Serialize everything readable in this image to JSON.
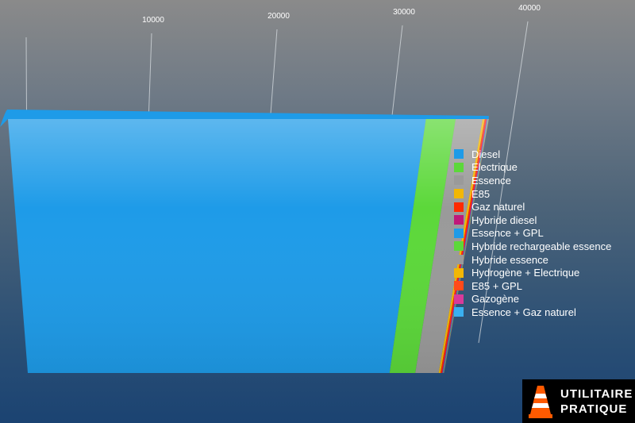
{
  "chart_data": {
    "type": "bar",
    "orientation": "horizontal",
    "stacked": true,
    "style": "3d",
    "grid": true,
    "legend_position": "right",
    "x_ticks": [
      10000,
      20000,
      30000,
      40000
    ],
    "xlim": [
      0,
      45000
    ],
    "series": [
      {
        "name": "Diesel",
        "value": 29500,
        "color": "#1e9be8"
      },
      {
        "name": "Electrique",
        "value": 2100,
        "color": "#5cd83a"
      },
      {
        "name": "Essence",
        "value": 1900,
        "color": "#9a9a9a"
      },
      {
        "name": "E85",
        "value": 150,
        "color": "#f2b705"
      },
      {
        "name": "Gaz naturel",
        "value": 120,
        "color": "#ff2a00"
      },
      {
        "name": "Hybride diesel",
        "value": 60,
        "color": "#c0187a"
      },
      {
        "name": "Essence + GPL",
        "value": 40,
        "color": "#1e9be8"
      },
      {
        "name": "Hybride rechargeable essence",
        "value": 20,
        "color": "#5cd83a"
      },
      {
        "name": "Hybride essence",
        "value": 20,
        "color": "#9a9a9a"
      },
      {
        "name": "Hydrogène + Electrique",
        "value": 10,
        "color": "#f2b705"
      },
      {
        "name": "E85 + GPL",
        "value": 10,
        "color": "#ff4a1a"
      },
      {
        "name": "Gazogène",
        "value": 5,
        "color": "#d83a9a"
      },
      {
        "name": "Essence + Gaz naturel",
        "value": 5,
        "color": "#3ab0f0"
      }
    ]
  },
  "logo": {
    "line1": "UTILITAIRE",
    "line2": "PRATIQUE"
  }
}
